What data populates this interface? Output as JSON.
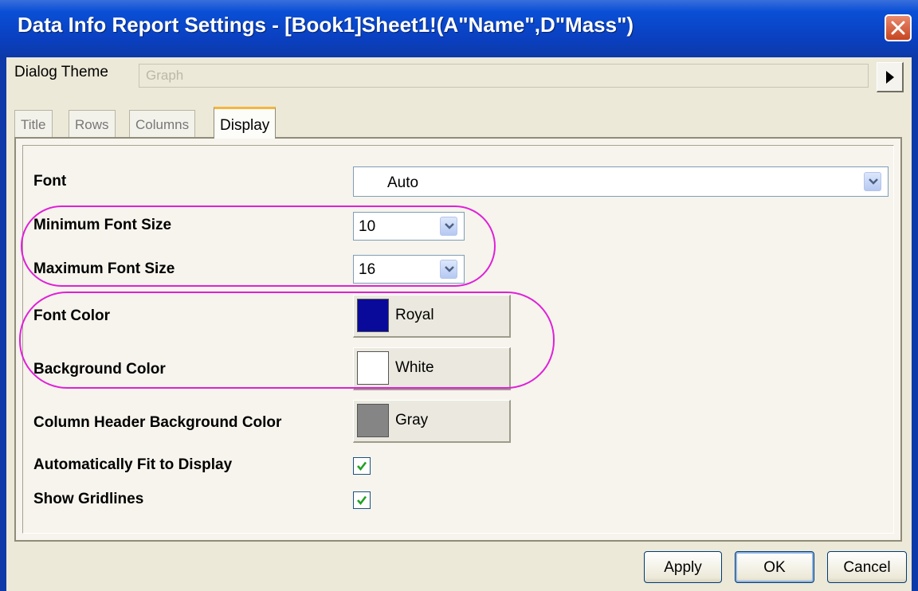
{
  "window": {
    "title": "Data Info Report Settings - [Book1]Sheet1!(A\"Name\",D\"Mass\")"
  },
  "theme": {
    "label": "Dialog Theme",
    "value": "Graph"
  },
  "tabs": [
    {
      "label": "Title",
      "active": false
    },
    {
      "label": "Rows",
      "active": false
    },
    {
      "label": "Columns",
      "active": false
    },
    {
      "label": "Display",
      "active": true
    }
  ],
  "display": {
    "font": {
      "label": "Font",
      "value": "Auto"
    },
    "min_font_size": {
      "label": "Minimum Font Size",
      "value": "10"
    },
    "max_font_size": {
      "label": "Maximum Font Size",
      "value": "16"
    },
    "font_color": {
      "label": "Font Color",
      "value": "Royal",
      "swatch": "#0a0a9a"
    },
    "background_color": {
      "label": "Background Color",
      "value": "White",
      "swatch": "#ffffff"
    },
    "header_bg_color": {
      "label": "Column Header Background Color",
      "value": "Gray",
      "swatch": "#858585"
    },
    "auto_fit": {
      "label": "Automatically Fit to Display",
      "checked": true
    },
    "show_gridlines": {
      "label": "Show Gridlines",
      "checked": true
    }
  },
  "buttons": {
    "apply": "Apply",
    "ok": "OK",
    "cancel": "Cancel"
  },
  "colors": {
    "titlebar": "#0a4fd6",
    "highlight": "#e020d8",
    "face": "#ece9d8"
  }
}
